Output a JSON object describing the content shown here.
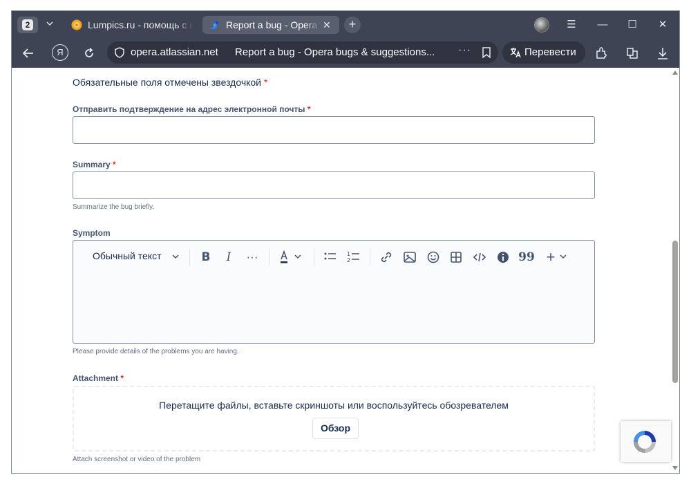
{
  "browser": {
    "tab_count": "2",
    "tabs": [
      {
        "title": "Lumpics.ru - помощь с компьютером",
        "favicon": "lumpics-favicon",
        "active": false
      },
      {
        "title": "Report a bug - Opera bugs & suggestions",
        "favicon": "jira-favicon",
        "active": true
      }
    ],
    "address": {
      "domain": "opera.atlassian.net",
      "page_title": "Report a bug - Opera bugs & suggestions..."
    },
    "translate_label": "Перевести",
    "colors": {
      "chrome": "#3f4454",
      "omnibox": "#2f3340",
      "active_tab": "#5a5f6f"
    }
  },
  "form": {
    "required_note": "Обязательные поля отмечены звездочкой",
    "required_mark": "*",
    "email": {
      "label": "Отправить подтверждение на адрес электронной почты",
      "value": "",
      "placeholder": ""
    },
    "summary": {
      "label": "Summary",
      "value": "",
      "placeholder": "",
      "helper": "Summarize the bug briefly."
    },
    "symptom": {
      "label": "Symptom",
      "text_style": "Обычный текст",
      "helper": "Please provide details of the problems you are having."
    },
    "attachment": {
      "label": "Attachment",
      "drop_text": "Перетащите файлы, вставьте скриншоты или воспользуйтесь обозревателем",
      "browse_label": "Обзор",
      "helper": "Attach screenshot or video of the problem"
    },
    "colors": {
      "text": "#172b4d",
      "label": "#44546f",
      "required": "#de350b",
      "border": "#8590a2"
    }
  }
}
